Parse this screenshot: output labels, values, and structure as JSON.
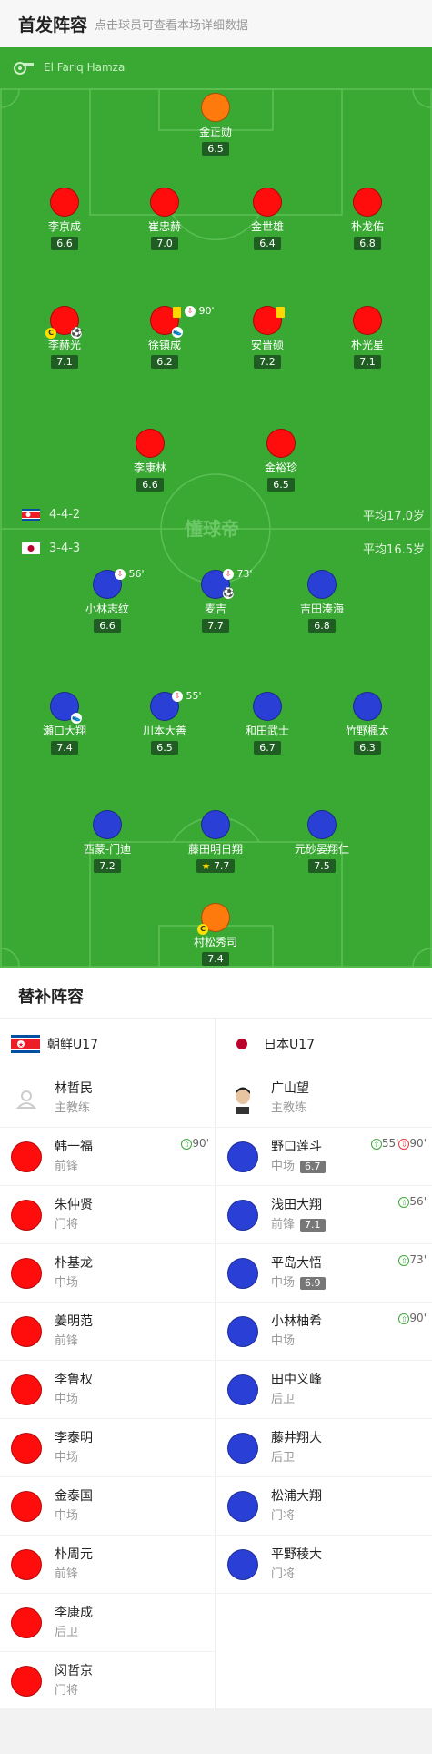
{
  "header": {
    "title": "首发阵容",
    "hint": "点击球员可查看本场详细数据"
  },
  "referee": "El Fariq Hamza",
  "watermark": "懂球帝",
  "home": {
    "formation": "4-4-2",
    "avg_age": "平均17.0岁",
    "color": "#ff0d0d",
    "gk": {
      "name": "金正勋",
      "rating": "6.5"
    },
    "def": [
      {
        "name": "李京成",
        "rating": "6.6"
      },
      {
        "name": "崔忠赫",
        "rating": "7.0"
      },
      {
        "name": "金世雄",
        "rating": "6.4"
      },
      {
        "name": "朴龙佑",
        "rating": "6.8"
      }
    ],
    "mid": [
      {
        "name": "李赫光",
        "rating": "7.1"
      },
      {
        "name": "徐镇成",
        "rating": "6.2",
        "sub_out": "90'"
      },
      {
        "name": "安晋硕",
        "rating": "7.2"
      },
      {
        "name": "朴光星",
        "rating": "7.1"
      }
    ],
    "fwd": [
      {
        "name": "李康林",
        "rating": "6.6"
      },
      {
        "name": "金裕珍",
        "rating": "6.5"
      }
    ]
  },
  "away": {
    "formation": "3-4-3",
    "avg_age": "平均16.5岁",
    "color": "#2a3fd6",
    "fwd": [
      {
        "name": "小林志纹",
        "rating": "6.6",
        "sub_out": "56'"
      },
      {
        "name": "麦吉",
        "rating": "7.7",
        "sub_out": "73'"
      },
      {
        "name": "吉田湊海",
        "rating": "6.8"
      }
    ],
    "mid": [
      {
        "name": "瀬口大翔",
        "rating": "7.4"
      },
      {
        "name": "川本大善",
        "rating": "6.5",
        "sub_out": "55'"
      },
      {
        "name": "和田武士",
        "rating": "6.7"
      },
      {
        "name": "竹野楓太",
        "rating": "6.3"
      }
    ],
    "def": [
      {
        "name": "西蒙-门迪",
        "rating": "7.2"
      },
      {
        "name": "藤田明日翔",
        "rating": "7.7"
      },
      {
        "name": "元砂晏翔仁",
        "rating": "7.5"
      }
    ],
    "gk": {
      "name": "村松秀司",
      "rating": "7.4"
    }
  },
  "subs": {
    "title": "替补阵容",
    "left": {
      "team": "朝鲜U17",
      "coach": {
        "name": "林哲民",
        "role": "主教练"
      },
      "players": [
        {
          "name": "韩一福",
          "pos": "前锋",
          "event": "90'"
        },
        {
          "name": "朱仲贤",
          "pos": "门将"
        },
        {
          "name": "朴基龙",
          "pos": "中场"
        },
        {
          "name": "姜明范",
          "pos": "前锋"
        },
        {
          "name": "李鲁权",
          "pos": "中场"
        },
        {
          "name": "李泰明",
          "pos": "中场"
        },
        {
          "name": "金泰国",
          "pos": "中场"
        },
        {
          "name": "朴周元",
          "pos": "前锋"
        },
        {
          "name": "李康成",
          "pos": "后卫"
        },
        {
          "name": "闵哲京",
          "pos": "门将"
        }
      ]
    },
    "right": {
      "team": "日本U17",
      "coach": {
        "name": "广山望",
        "role": "主教练"
      },
      "players": [
        {
          "name": "野口莲斗",
          "pos": "中场",
          "rating": "6.7",
          "event_in": "55'",
          "event_out": "90'"
        },
        {
          "name": "浅田大翔",
          "pos": "前锋",
          "rating": "7.1",
          "event_in": "56'"
        },
        {
          "name": "平岛大悟",
          "pos": "中场",
          "rating": "6.9",
          "event_in": "73'"
        },
        {
          "name": "小林柚希",
          "pos": "中场",
          "event_in": "90'"
        },
        {
          "name": "田中义峰",
          "pos": "后卫"
        },
        {
          "name": "藤井翔大",
          "pos": "后卫"
        },
        {
          "name": "松浦大翔",
          "pos": "门将"
        },
        {
          "name": "平野稜大",
          "pos": "门将"
        }
      ]
    }
  }
}
